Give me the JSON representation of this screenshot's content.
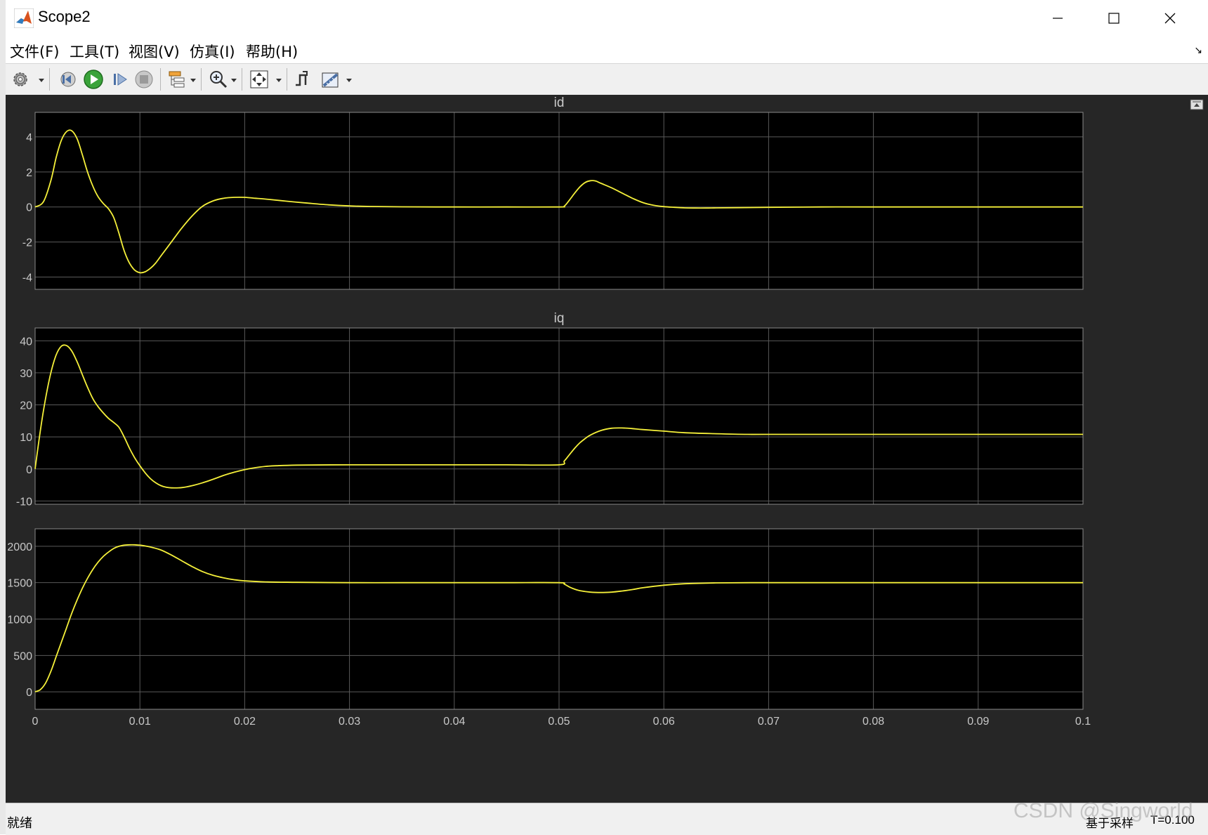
{
  "window": {
    "title": "Scope2",
    "minimize_glyph": "—",
    "maximize_glyph": "☐",
    "close_glyph": "✕"
  },
  "menu": {
    "items": [
      "文件(F)",
      "工具(T)",
      "视图(V)",
      "仿真(I)",
      "帮助(H)"
    ],
    "pin_glyph": "↘"
  },
  "toolbar": {
    "icons": [
      "settings-gear-icon",
      "step-back-icon",
      "run-icon",
      "step-forward-icon",
      "stop-icon",
      "signal-hierarchy-icon",
      "zoom-in-icon",
      "fit-to-view-icon",
      "triggers-icon",
      "measurements-ruler-icon"
    ]
  },
  "status": {
    "ready": "就绪",
    "sample_mode": "基于采样",
    "time": "T=0.100"
  },
  "watermark": "CSDN @Singworld",
  "colors": {
    "trace": "#f5f03a",
    "axes_bg": "#000000",
    "figure_bg": "#262626",
    "grid": "#5a5a5a",
    "label": "#c8c8c8"
  },
  "chart_data": [
    {
      "type": "line",
      "title": "id",
      "xlim": [
        0,
        0.1
      ],
      "ylim": [
        -4.7,
        5.4
      ],
      "yticks": [
        -4,
        -2,
        0,
        2,
        4
      ],
      "xticks": [
        0,
        0.01,
        0.02,
        0.03,
        0.04,
        0.05,
        0.06,
        0.07,
        0.08,
        0.09,
        0.1
      ],
      "show_xticklabels": false,
      "grid": true,
      "series": [
        {
          "x": [
            0,
            0.0008,
            0.0015,
            0.002,
            0.0025,
            0.003,
            0.0035,
            0.004,
            0.0045,
            0.005,
            0.0055,
            0.006,
            0.0065,
            0.007,
            0.0075,
            0.008,
            0.0085,
            0.009,
            0.0095,
            0.01,
            0.0105,
            0.011,
            0.0115,
            0.012,
            0.013,
            0.014,
            0.015,
            0.016,
            0.017,
            0.018,
            0.019,
            0.02,
            0.021,
            0.022,
            0.024,
            0.026,
            0.028,
            0.03,
            0.032,
            0.035,
            0.04,
            0.045,
            0.05,
            0.0505,
            0.051,
            0.0515,
            0.052,
            0.0525,
            0.053,
            0.0535,
            0.054,
            0.055,
            0.056,
            0.057,
            0.058,
            0.059,
            0.06,
            0.061,
            0.062,
            0.063,
            0.064,
            0.065,
            0.067,
            0.07,
            0.075,
            0.08,
            0.09,
            0.1
          ],
          "y": [
            0,
            0.3,
            1.5,
            2.8,
            3.8,
            4.3,
            4.35,
            3.9,
            3.0,
            2.0,
            1.2,
            0.6,
            0.2,
            -0.1,
            -0.6,
            -1.5,
            -2.5,
            -3.2,
            -3.6,
            -3.75,
            -3.7,
            -3.5,
            -3.2,
            -2.8,
            -2.0,
            -1.2,
            -0.5,
            0.05,
            0.35,
            0.5,
            0.55,
            0.55,
            0.5,
            0.45,
            0.33,
            0.22,
            0.12,
            0.06,
            0.03,
            0.01,
            0,
            0,
            0,
            0.05,
            0.4,
            0.8,
            1.15,
            1.4,
            1.5,
            1.48,
            1.35,
            1.1,
            0.8,
            0.5,
            0.25,
            0.1,
            0.02,
            -0.02,
            -0.05,
            -0.06,
            -0.06,
            -0.05,
            -0.04,
            -0.02,
            0,
            0,
            0,
            0
          ]
        }
      ]
    },
    {
      "type": "line",
      "title": "iq",
      "xlim": [
        0,
        0.1
      ],
      "ylim": [
        -11,
        44
      ],
      "yticks": [
        -10,
        0,
        10,
        20,
        30,
        40
      ],
      "xticks": [
        0,
        0.01,
        0.02,
        0.03,
        0.04,
        0.05,
        0.06,
        0.07,
        0.08,
        0.09,
        0.1
      ],
      "show_xticklabels": false,
      "grid": true,
      "series": [
        {
          "x": [
            0,
            0.0005,
            0.001,
            0.0015,
            0.002,
            0.0025,
            0.003,
            0.0035,
            0.004,
            0.0045,
            0.005,
            0.0055,
            0.006,
            0.0065,
            0.007,
            0.0075,
            0.008,
            0.0085,
            0.009,
            0.0095,
            0.01,
            0.0105,
            0.011,
            0.0115,
            0.012,
            0.0125,
            0.013,
            0.014,
            0.015,
            0.016,
            0.017,
            0.018,
            0.019,
            0.02,
            0.021,
            0.022,
            0.023,
            0.025,
            0.03,
            0.035,
            0.04,
            0.045,
            0.05,
            0.0505,
            0.051,
            0.0515,
            0.052,
            0.0525,
            0.053,
            0.054,
            0.055,
            0.056,
            0.057,
            0.058,
            0.06,
            0.062,
            0.065,
            0.068,
            0.07,
            0.08,
            0.09,
            0.1
          ],
          "y": [
            0,
            12,
            22,
            30,
            35.5,
            38.3,
            38.5,
            36.8,
            33.5,
            29.5,
            25.5,
            22.0,
            19.5,
            17.5,
            15.8,
            14.5,
            13.0,
            10.0,
            6.5,
            3.5,
            1.0,
            -1.2,
            -3.0,
            -4.3,
            -5.2,
            -5.7,
            -5.9,
            -5.8,
            -5.2,
            -4.3,
            -3.2,
            -2.0,
            -1.0,
            -0.2,
            0.4,
            0.8,
            1.0,
            1.2,
            1.3,
            1.3,
            1.3,
            1.3,
            1.3,
            2.5,
            4.5,
            6.5,
            8.2,
            9.5,
            10.6,
            12.0,
            12.7,
            12.8,
            12.6,
            12.3,
            11.8,
            11.3,
            11.0,
            10.8,
            10.8,
            10.8,
            10.8,
            10.8
          ]
        }
      ]
    },
    {
      "type": "line",
      "title": "",
      "xlim": [
        0,
        0.1
      ],
      "ylim": [
        -240,
        2240
      ],
      "yticks": [
        0,
        500,
        1000,
        1500,
        2000
      ],
      "xticks": [
        0,
        0.01,
        0.02,
        0.03,
        0.04,
        0.05,
        0.06,
        0.07,
        0.08,
        0.09,
        0.1
      ],
      "xticklabels": [
        "0",
        "0.01",
        "0.02",
        "0.03",
        "0.04",
        "0.05",
        "0.06",
        "0.07",
        "0.08",
        "0.09",
        "0.1"
      ],
      "show_xticklabels": true,
      "grid": true,
      "series": [
        {
          "x": [
            0,
            0.0005,
            0.001,
            0.0015,
            0.002,
            0.0025,
            0.003,
            0.0035,
            0.004,
            0.0045,
            0.005,
            0.0055,
            0.006,
            0.0065,
            0.007,
            0.0075,
            0.008,
            0.0085,
            0.009,
            0.0095,
            0.01,
            0.0105,
            0.011,
            0.012,
            0.013,
            0.014,
            0.015,
            0.016,
            0.017,
            0.018,
            0.019,
            0.02,
            0.022,
            0.025,
            0.03,
            0.035,
            0.04,
            0.045,
            0.05,
            0.0505,
            0.051,
            0.0515,
            0.052,
            0.053,
            0.054,
            0.055,
            0.056,
            0.057,
            0.058,
            0.06,
            0.062,
            0.065,
            0.07,
            0.075,
            0.08,
            0.09,
            0.1
          ],
          "y": [
            0,
            30,
            120,
            280,
            480,
            680,
            880,
            1080,
            1260,
            1420,
            1560,
            1680,
            1780,
            1860,
            1920,
            1970,
            2000,
            2015,
            2020,
            2020,
            2015,
            2005,
            1990,
            1950,
            1880,
            1800,
            1720,
            1650,
            1600,
            1565,
            1540,
            1525,
            1510,
            1505,
            1500,
            1500,
            1500,
            1500,
            1500,
            1480,
            1440,
            1410,
            1390,
            1370,
            1365,
            1370,
            1385,
            1405,
            1430,
            1465,
            1485,
            1497,
            1500,
            1500,
            1500,
            1500,
            1500
          ]
        }
      ]
    }
  ]
}
